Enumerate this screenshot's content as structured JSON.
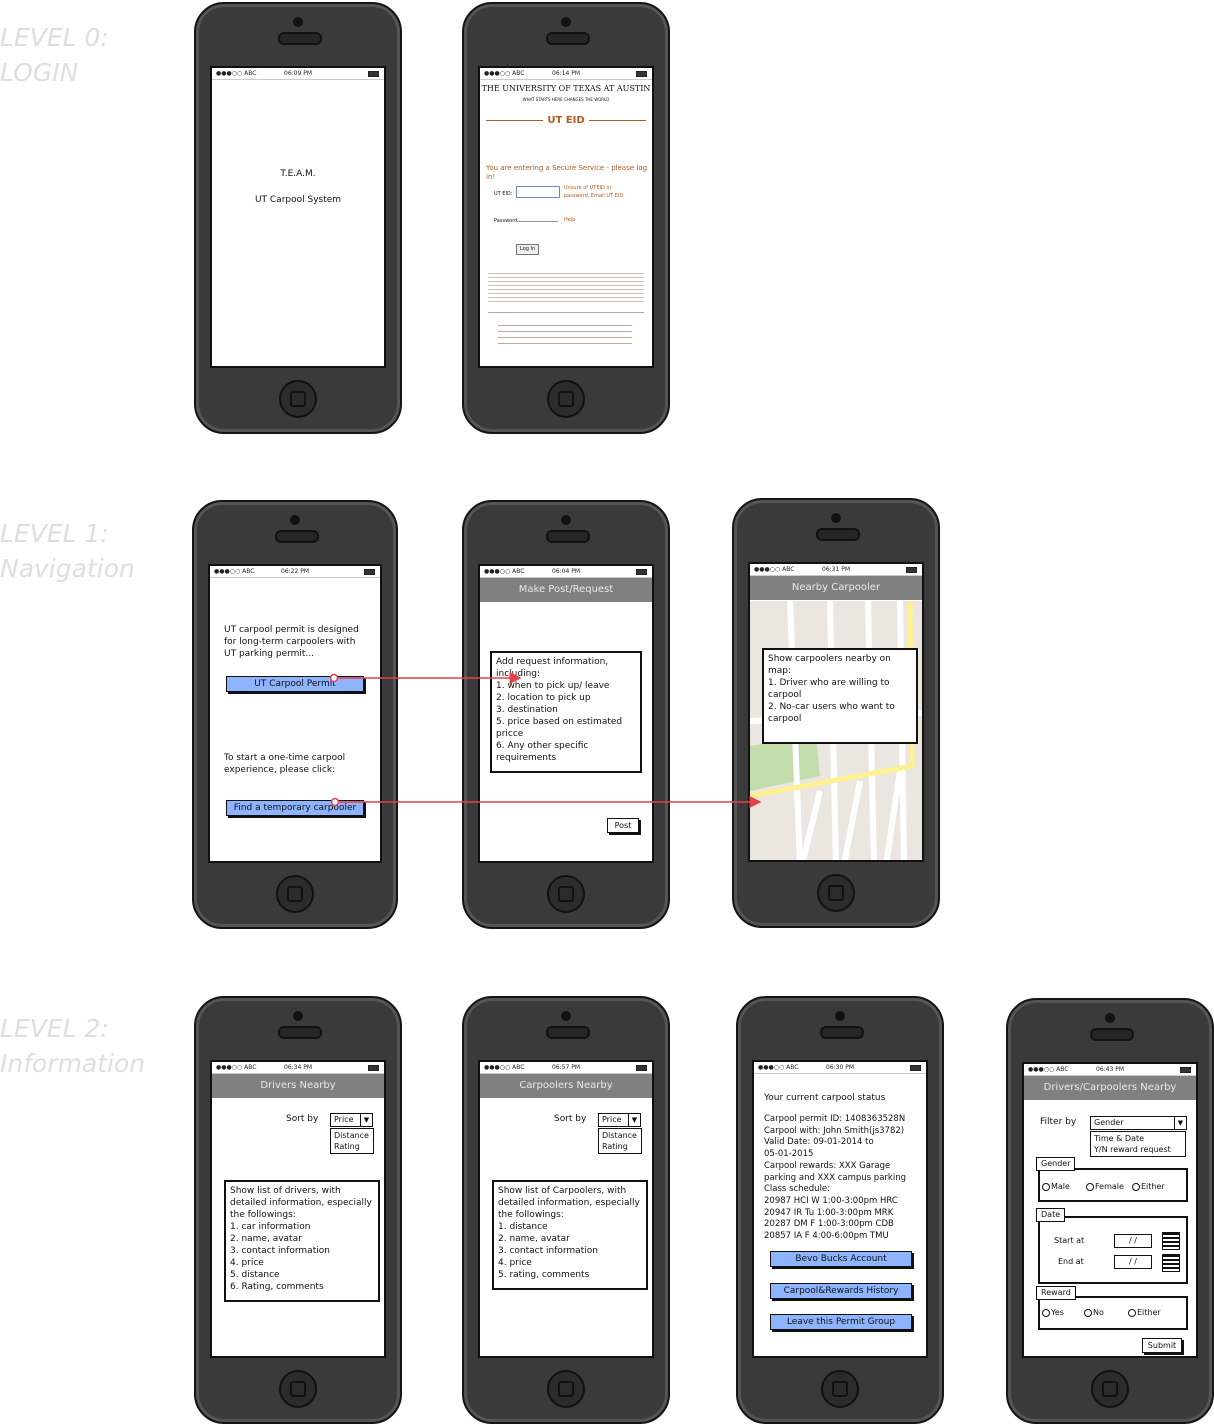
{
  "levels": [
    {
      "line1": "LEVEL 0:",
      "line2": "LOGIN"
    },
    {
      "line1": "LEVEL 1:",
      "line2": "Navigation"
    },
    {
      "line1": "LEVEL 2:",
      "line2": "Information"
    }
  ],
  "status": {
    "carrier": "●●●○○ ABC"
  },
  "login_splash": {
    "time": "06:09 PM",
    "team": "T.E.A.M.",
    "app": "UT Carpool System"
  },
  "ut_login": {
    "time": "06:14 PM",
    "university": "THE UNIVERSITY OF TEXAS AT AUSTIN",
    "tagline": "WHAT STARTS HERE CHANGES THE WORLD",
    "logo": "UT EID",
    "secure_msg": "You are entering a Secure Service - please log in!",
    "eid_label": "UT EID:",
    "eid_hint": "Unsure of UTEID or password, Email UT EID",
    "password_label": "Password:",
    "help": "Help",
    "login_button": "Log In"
  },
  "home": {
    "time": "06:22 PM",
    "permit_text": "UT carpool permit is designed for long-term carpoolers with UT parking permit...",
    "permit_button": "UT Carpool Permit",
    "temp_text": "To start a one-time carpool experience, please click:",
    "temp_button": "Find a temporary carpooler"
  },
  "post": {
    "time": "06:04 PM",
    "title": "Make Post/Request",
    "box": [
      "Add request information,",
      "including:",
      "1. when to pick up/ leave",
      "2. location to pick up",
      "3. destination",
      "5. price based on estimated pricce",
      "6. Any other specific requirements"
    ],
    "post_button": "Post"
  },
  "nearby": {
    "time": "06:31 PM",
    "title": "Nearby Carpooler",
    "box": [
      "Show carpoolers nearby on map:",
      "1. Driver who are willing to carpool",
      "2. No-car users who want to carpool"
    ]
  },
  "drivers": {
    "time": "06:34 PM",
    "title": "Drivers Nearby",
    "sort_label": "Sort by",
    "sort_value": "Price",
    "sort_options": [
      "Distance",
      "Rating"
    ],
    "box": [
      "Show list of drivers, with detailed information, especially the followings:",
      "1. car information",
      "2. name, avatar",
      "3. contact information",
      "4. price",
      "5. distance",
      "6. Rating, comments"
    ]
  },
  "carpoolers": {
    "time": "06:57 PM",
    "title": "Carpoolers Nearby",
    "sort_label": "Sort by",
    "sort_value": "Price",
    "sort_options": [
      "Distance",
      "Rating"
    ],
    "box": [
      "Show list of Carpoolers, with detailed information, especially the followings:",
      "1. distance",
      "2. name, avatar",
      "3. contact information",
      "4. price",
      "5. rating, comments"
    ]
  },
  "status_screen": {
    "time": "06:30 PM",
    "heading": "Your current carpool status",
    "lines": [
      "Carpool permit ID: 1408363528N",
      "Carpool with: John Smith(js3782)",
      "Valid Date: 09-01-2014   to",
      "05-01-2015",
      "Carpool rewards: XXX Garage",
      "parking and XXX campus parking",
      "Class schedule:",
      "20987 HCI W 1:00-3:00pm HRC",
      "20947 IR Tu 1:00-3:00pm MRK",
      "20287 DM F 1:00-3:00pm CDB",
      "20857 IA F 4:00-6:00pm TMU"
    ],
    "buttons": [
      "Bevo Bucks Account",
      "Carpool&Rewards History",
      "Leave this Permit Group"
    ]
  },
  "filter": {
    "time": "06:43 PM",
    "title": "Drivers/Carpoolers Nearby",
    "filter_label": "Filter by",
    "filter_value": "Gender",
    "filter_options": [
      "Time & Date",
      "Y/N reward request"
    ],
    "gender_label": "Gender",
    "gender_options": [
      "Male",
      "Female",
      "Either"
    ],
    "date_label": "Date",
    "start_label": "Start at",
    "end_label": "End at",
    "date_placeholder": "/ /",
    "reward_label": "Reward",
    "reward_options": [
      "Yes",
      "No",
      "Either"
    ],
    "submit": "Submit"
  },
  "colors": {
    "button_blue": "#8eb4ff",
    "arrow": "#e8404a",
    "titlebar": "#808080",
    "map_bg": "#ebe7e0",
    "map_park": "#c2dcac",
    "map_road": "#fdf190"
  }
}
